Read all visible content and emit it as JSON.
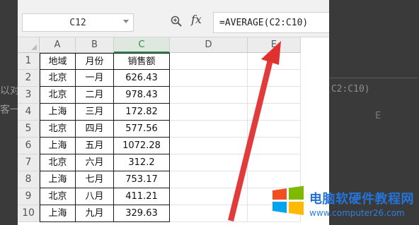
{
  "toolbar": {
    "name_box": "C12",
    "fx_label": "fx",
    "formula": "=AVERAGE(C2:C10)"
  },
  "columns": [
    "A",
    "B",
    "C",
    "D",
    "E"
  ],
  "selected_column": "C",
  "rows": [
    {
      "num": "1",
      "a": "地域",
      "b": "月份",
      "c": "销售额"
    },
    {
      "num": "2",
      "a": "北京",
      "b": "一月",
      "c": "626.43"
    },
    {
      "num": "3",
      "a": "北京",
      "b": "二月",
      "c": "978.43"
    },
    {
      "num": "4",
      "a": "上海",
      "b": "三月",
      "c": "172.82"
    },
    {
      "num": "5",
      "a": "北京",
      "b": "四月",
      "c": "577.56"
    },
    {
      "num": "6",
      "a": "上海",
      "b": "五月",
      "c": "1072.28"
    },
    {
      "num": "7",
      "a": "北京",
      "b": "六月",
      "c": "312.2"
    },
    {
      "num": "8",
      "a": "上海",
      "b": "七月",
      "c": "753.17"
    },
    {
      "num": "9",
      "a": "北京",
      "b": "八月",
      "c": "411.21"
    },
    {
      "num": "10",
      "a": "上海",
      "b": "九月",
      "c": "329.63"
    }
  ],
  "background": {
    "left_text": [
      "以对",
      "客一"
    ],
    "ghost_formula": "(C2:C10)",
    "ghost_col": "E"
  },
  "watermark": {
    "title": "电脑软硬件教程网",
    "url": "www.computer26.com"
  },
  "colors": {
    "accent_green": "#2e8b57",
    "arrow_red": "#e03030",
    "watermark_blue": "#2573d9"
  }
}
